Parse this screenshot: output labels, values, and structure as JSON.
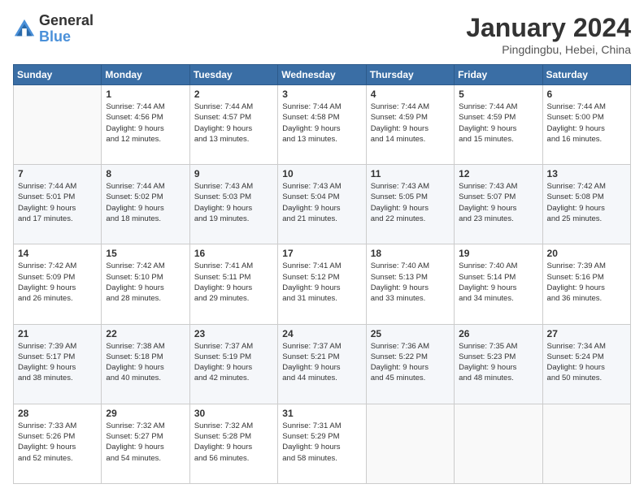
{
  "logo": {
    "line1": "General",
    "line2": "Blue"
  },
  "header": {
    "title": "January 2024",
    "subtitle": "Pingdingbu, Hebei, China"
  },
  "weekdays": [
    "Sunday",
    "Monday",
    "Tuesday",
    "Wednesday",
    "Thursday",
    "Friday",
    "Saturday"
  ],
  "weeks": [
    [
      {
        "day": "",
        "sunrise": "",
        "sunset": "",
        "daylight": ""
      },
      {
        "day": "1",
        "sunrise": "Sunrise: 7:44 AM",
        "sunset": "Sunset: 4:56 PM",
        "daylight": "Daylight: 9 hours and 12 minutes."
      },
      {
        "day": "2",
        "sunrise": "Sunrise: 7:44 AM",
        "sunset": "Sunset: 4:57 PM",
        "daylight": "Daylight: 9 hours and 13 minutes."
      },
      {
        "day": "3",
        "sunrise": "Sunrise: 7:44 AM",
        "sunset": "Sunset: 4:58 PM",
        "daylight": "Daylight: 9 hours and 13 minutes."
      },
      {
        "day": "4",
        "sunrise": "Sunrise: 7:44 AM",
        "sunset": "Sunset: 4:59 PM",
        "daylight": "Daylight: 9 hours and 14 minutes."
      },
      {
        "day": "5",
        "sunrise": "Sunrise: 7:44 AM",
        "sunset": "Sunset: 4:59 PM",
        "daylight": "Daylight: 9 hours and 15 minutes."
      },
      {
        "day": "6",
        "sunrise": "Sunrise: 7:44 AM",
        "sunset": "Sunset: 5:00 PM",
        "daylight": "Daylight: 9 hours and 16 minutes."
      }
    ],
    [
      {
        "day": "7",
        "sunrise": "Sunrise: 7:44 AM",
        "sunset": "Sunset: 5:01 PM",
        "daylight": "Daylight: 9 hours and 17 minutes."
      },
      {
        "day": "8",
        "sunrise": "Sunrise: 7:44 AM",
        "sunset": "Sunset: 5:02 PM",
        "daylight": "Daylight: 9 hours and 18 minutes."
      },
      {
        "day": "9",
        "sunrise": "Sunrise: 7:43 AM",
        "sunset": "Sunset: 5:03 PM",
        "daylight": "Daylight: 9 hours and 19 minutes."
      },
      {
        "day": "10",
        "sunrise": "Sunrise: 7:43 AM",
        "sunset": "Sunset: 5:04 PM",
        "daylight": "Daylight: 9 hours and 21 minutes."
      },
      {
        "day": "11",
        "sunrise": "Sunrise: 7:43 AM",
        "sunset": "Sunset: 5:05 PM",
        "daylight": "Daylight: 9 hours and 22 minutes."
      },
      {
        "day": "12",
        "sunrise": "Sunrise: 7:43 AM",
        "sunset": "Sunset: 5:07 PM",
        "daylight": "Daylight: 9 hours and 23 minutes."
      },
      {
        "day": "13",
        "sunrise": "Sunrise: 7:42 AM",
        "sunset": "Sunset: 5:08 PM",
        "daylight": "Daylight: 9 hours and 25 minutes."
      }
    ],
    [
      {
        "day": "14",
        "sunrise": "Sunrise: 7:42 AM",
        "sunset": "Sunset: 5:09 PM",
        "daylight": "Daylight: 9 hours and 26 minutes."
      },
      {
        "day": "15",
        "sunrise": "Sunrise: 7:42 AM",
        "sunset": "Sunset: 5:10 PM",
        "daylight": "Daylight: 9 hours and 28 minutes."
      },
      {
        "day": "16",
        "sunrise": "Sunrise: 7:41 AM",
        "sunset": "Sunset: 5:11 PM",
        "daylight": "Daylight: 9 hours and 29 minutes."
      },
      {
        "day": "17",
        "sunrise": "Sunrise: 7:41 AM",
        "sunset": "Sunset: 5:12 PM",
        "daylight": "Daylight: 9 hours and 31 minutes."
      },
      {
        "day": "18",
        "sunrise": "Sunrise: 7:40 AM",
        "sunset": "Sunset: 5:13 PM",
        "daylight": "Daylight: 9 hours and 33 minutes."
      },
      {
        "day": "19",
        "sunrise": "Sunrise: 7:40 AM",
        "sunset": "Sunset: 5:14 PM",
        "daylight": "Daylight: 9 hours and 34 minutes."
      },
      {
        "day": "20",
        "sunrise": "Sunrise: 7:39 AM",
        "sunset": "Sunset: 5:16 PM",
        "daylight": "Daylight: 9 hours and 36 minutes."
      }
    ],
    [
      {
        "day": "21",
        "sunrise": "Sunrise: 7:39 AM",
        "sunset": "Sunset: 5:17 PM",
        "daylight": "Daylight: 9 hours and 38 minutes."
      },
      {
        "day": "22",
        "sunrise": "Sunrise: 7:38 AM",
        "sunset": "Sunset: 5:18 PM",
        "daylight": "Daylight: 9 hours and 40 minutes."
      },
      {
        "day": "23",
        "sunrise": "Sunrise: 7:37 AM",
        "sunset": "Sunset: 5:19 PM",
        "daylight": "Daylight: 9 hours and 42 minutes."
      },
      {
        "day": "24",
        "sunrise": "Sunrise: 7:37 AM",
        "sunset": "Sunset: 5:21 PM",
        "daylight": "Daylight: 9 hours and 44 minutes."
      },
      {
        "day": "25",
        "sunrise": "Sunrise: 7:36 AM",
        "sunset": "Sunset: 5:22 PM",
        "daylight": "Daylight: 9 hours and 45 minutes."
      },
      {
        "day": "26",
        "sunrise": "Sunrise: 7:35 AM",
        "sunset": "Sunset: 5:23 PM",
        "daylight": "Daylight: 9 hours and 48 minutes."
      },
      {
        "day": "27",
        "sunrise": "Sunrise: 7:34 AM",
        "sunset": "Sunset: 5:24 PM",
        "daylight": "Daylight: 9 hours and 50 minutes."
      }
    ],
    [
      {
        "day": "28",
        "sunrise": "Sunrise: 7:33 AM",
        "sunset": "Sunset: 5:26 PM",
        "daylight": "Daylight: 9 hours and 52 minutes."
      },
      {
        "day": "29",
        "sunrise": "Sunrise: 7:32 AM",
        "sunset": "Sunset: 5:27 PM",
        "daylight": "Daylight: 9 hours and 54 minutes."
      },
      {
        "day": "30",
        "sunrise": "Sunrise: 7:32 AM",
        "sunset": "Sunset: 5:28 PM",
        "daylight": "Daylight: 9 hours and 56 minutes."
      },
      {
        "day": "31",
        "sunrise": "Sunrise: 7:31 AM",
        "sunset": "Sunset: 5:29 PM",
        "daylight": "Daylight: 9 hours and 58 minutes."
      },
      {
        "day": "",
        "sunrise": "",
        "sunset": "",
        "daylight": ""
      },
      {
        "day": "",
        "sunrise": "",
        "sunset": "",
        "daylight": ""
      },
      {
        "day": "",
        "sunrise": "",
        "sunset": "",
        "daylight": ""
      }
    ]
  ]
}
